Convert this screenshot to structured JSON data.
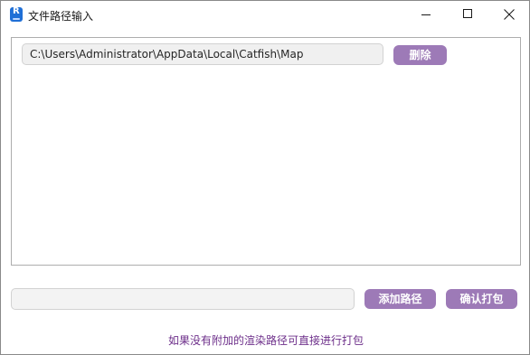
{
  "window": {
    "title": "文件路径输入"
  },
  "path_list": {
    "items": [
      {
        "path": "C:\\Users\\Administrator\\AppData\\Local\\Catfish\\Map",
        "delete_label": "删除"
      }
    ]
  },
  "footer": {
    "path_input_value": "",
    "add_path_label": "添加路径",
    "confirm_pack_label": "确认打包",
    "hint": "如果没有附加的渲染路径可直接进行打包"
  },
  "colors": {
    "accent": "#9d7ab7",
    "hint_text": "#6d2f8a"
  },
  "icons": [
    "app-icon",
    "minimize-icon",
    "maximize-icon",
    "close-icon"
  ]
}
